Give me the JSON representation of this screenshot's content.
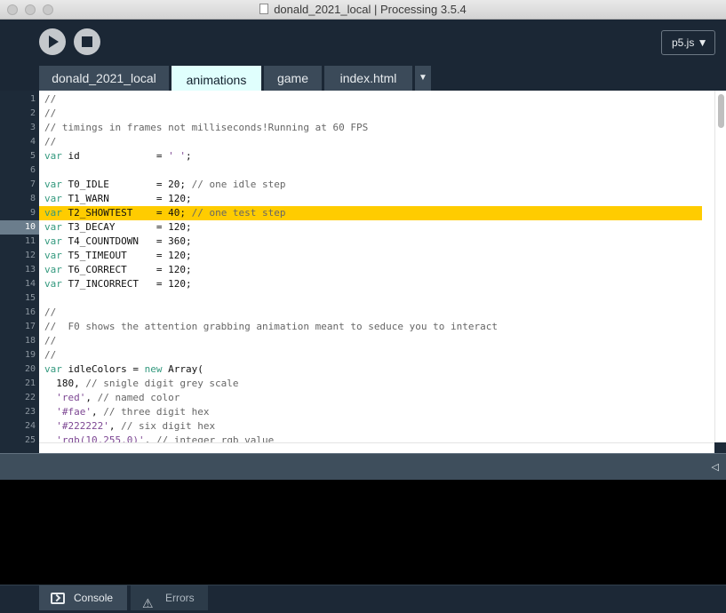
{
  "window": {
    "title": "donald_2021_local | Processing 3.5.4"
  },
  "toolbar": {
    "run_label": "Run",
    "stop_label": "Stop",
    "mode": "p5.js ▼"
  },
  "tabs": [
    {
      "label": "donald_2021_local",
      "active": false
    },
    {
      "label": "animations",
      "active": true
    },
    {
      "label": "game",
      "active": false
    },
    {
      "label": "index.html",
      "active": false
    }
  ],
  "tab_menu_glyph": "▼",
  "editor": {
    "current_line": 10,
    "highlighted_line": 9,
    "lines": [
      {
        "n": "1",
        "text": "//"
      },
      {
        "n": "2",
        "text": "//"
      },
      {
        "n": "3",
        "text": "// timings in frames not milliseconds!Running at 60 FPS"
      },
      {
        "n": "4",
        "text": "//"
      },
      {
        "n": "5",
        "text": "var id             = ' ';"
      },
      {
        "n": "6",
        "text": ""
      },
      {
        "n": "7",
        "text": "var T0_IDLE        = 20; // one idle step"
      },
      {
        "n": "8",
        "text": "var T1_WARN        = 120;"
      },
      {
        "n": "9",
        "text": "var T2_SHOWTEST    = 40; // one test step"
      },
      {
        "n": "10",
        "text": "var T3_DECAY       = 120;"
      },
      {
        "n": "11",
        "text": "var T4_COUNTDOWN   = 360;"
      },
      {
        "n": "12",
        "text": "var T5_TIMEOUT     = 120;"
      },
      {
        "n": "13",
        "text": "var T6_CORRECT     = 120;"
      },
      {
        "n": "14",
        "text": "var T7_INCORRECT   = 120;"
      },
      {
        "n": "15",
        "text": ""
      },
      {
        "n": "16",
        "text": "//"
      },
      {
        "n": "17",
        "text": "//  F0 shows the attention grabbing animation meant to seduce you to interact"
      },
      {
        "n": "18",
        "text": "//"
      },
      {
        "n": "19",
        "text": "//"
      },
      {
        "n": "20",
        "text": "var idleColors = new Array("
      },
      {
        "n": "21",
        "text": "  180, // snigle digit grey scale"
      },
      {
        "n": "22",
        "text": "  'red', // named color"
      },
      {
        "n": "23",
        "text": "  '#fae', // three digit hex"
      },
      {
        "n": "24",
        "text": "  '#222222', // six digit hex"
      },
      {
        "n": "25",
        "text": "  'rgb(10,255,0)', // integer rgb value"
      }
    ]
  },
  "footer": {
    "console_label": "Console",
    "errors_label": "Errors"
  },
  "colors": {
    "highlight": "#ffcc00",
    "keyword": "#33997e",
    "comment": "#666666",
    "string": "#7d4793",
    "active_tab": "#e0fffd"
  }
}
